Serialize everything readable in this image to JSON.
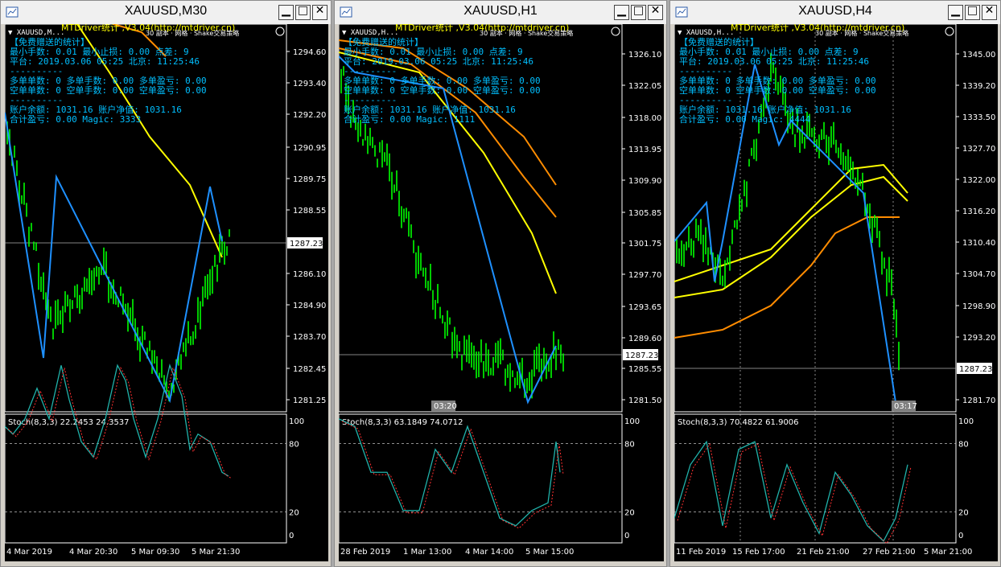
{
  "windows": [
    {
      "title": "XAUUSD,M30",
      "symbol_label": "XAUUSD,M...",
      "ea_title": "MTDriver统计 ,V3.04(http://mtdriver.cn)",
      "ea_sublabel": "30 副本 · 网格 · Shake交易策略",
      "info_lines": [
        "【免费赠送的统计】",
        "最小手数: 0.01  最小止损: 0.00  点差: 9",
        "平台: 2019.03.06 05:25  北京: 11:25:46",
        "----------",
        "多单单数: 0  多单手数: 0.00  多单盈亏: 0.00",
        "空单单数: 0  空单手数: 0.00  空单盈亏: 0.00",
        "----------",
        "账户余额: 1031.16  账户净值: 1031.16",
        "合计盈亏: 0.00  Magic: 3333"
      ],
      "price_ticks": [
        "1294.60",
        "1293.40",
        "1292.20",
        "1290.95",
        "1289.75",
        "1288.55",
        "1287.23",
        "1286.10",
        "1284.90",
        "1283.70",
        "1282.45",
        "1281.25"
      ],
      "current_price": "1287.23",
      "stoch_label": "Stoch(8,3,3) 22.2453 24.3537",
      "stoch_ticks": [
        "100",
        "80",
        "20",
        "0"
      ],
      "time_labels": [
        "4 Mar 2019",
        "4 Mar 20:30",
        "5 Mar 09:30",
        "5 Mar 21:30"
      ],
      "time_marker": ""
    },
    {
      "title": "XAUUSD,H1",
      "symbol_label": "XAUUSD,H...",
      "ea_title": "MTDriver统计 ,V3.04(http://mtdriver.cn)",
      "ea_sublabel": "30 副本 · 网格 · Shake交易策略",
      "info_lines": [
        "【免费赠送的统计】",
        "最小手数: 0.01  最小止损: 0.00  点差: 9",
        "平台: 2019.03.06 05:25  北京: 11:25:46",
        "----------",
        "多单单数: 0  多单手数: 0.00  多单盈亏: 0.00",
        "空单单数: 0  空单手数: 0.00  空单盈亏: 0.00",
        "----------",
        "账户余额: 1031.16  账户净值: 1031.16",
        "合计盈亏: 0.00  Magic: 1111"
      ],
      "price_ticks": [
        "1326.10",
        "1322.05",
        "1318.00",
        "1313.95",
        "1309.90",
        "1305.85",
        "1301.75",
        "1297.70",
        "1293.65",
        "1289.60",
        "1287.23",
        "1285.55",
        "1281.50"
      ],
      "current_price": "1287.23",
      "stoch_label": "Stoch(8,3,3) 63.1849 74.0712",
      "stoch_ticks": [
        "100",
        "80",
        "20",
        "0"
      ],
      "time_labels": [
        "28 Feb 2019",
        "1 Mar 13:00",
        "4 Mar 14:00",
        "5 Mar 15:00"
      ],
      "time_marker": "03:20"
    },
    {
      "title": "XAUUSD,H4",
      "symbol_label": "XAUUSD,H...",
      "ea_title": "MTDriver统计 ,V3.04(http://mtdriver.cn)",
      "ea_sublabel": "30 副本 · 网格 · Shake交易策略",
      "info_lines": [
        "【免费赠送的统计】",
        "最小手数: 0.01  最小止损: 0.00  点差: 9",
        "平台: 2019.03.06 05:25  北京: 11:25:46",
        "----------",
        "多单单数: 0  多单手数: 0.00  多单盈亏: 0.00",
        "空单单数: 0  空单手数: 0.00  空单盈亏: 0.00",
        "----------",
        "账户余额: 1031.16  账户净值: 1031.16",
        "合计盈亏: 0.00  Magic: 4444"
      ],
      "price_ticks": [
        "1345.00",
        "1339.20",
        "1333.50",
        "1327.70",
        "1322.00",
        "1316.20",
        "1310.40",
        "1304.70",
        "1298.90",
        "1293.20",
        "1287.23",
        "1281.70"
      ],
      "current_price": "1287.23",
      "stoch_label": "Stoch(8,3,3) 70.4822 61.9006",
      "stoch_ticks": [
        "100",
        "80",
        "20",
        "0"
      ],
      "time_labels": [
        "11 Feb 2019",
        "15 Feb 17:00",
        "21 Feb 21:00",
        "27 Feb 21:00",
        "5 Mar 21:00"
      ],
      "time_marker": "03:17"
    }
  ],
  "colors": {
    "background": "#000000",
    "candle": "#00ff00",
    "zigzag": "#1e90ff",
    "ma_yellow": "#ffff00",
    "ma_orange": "#ff8c00",
    "info_text": "#00bfff",
    "grid": "#c0c0c0"
  }
}
